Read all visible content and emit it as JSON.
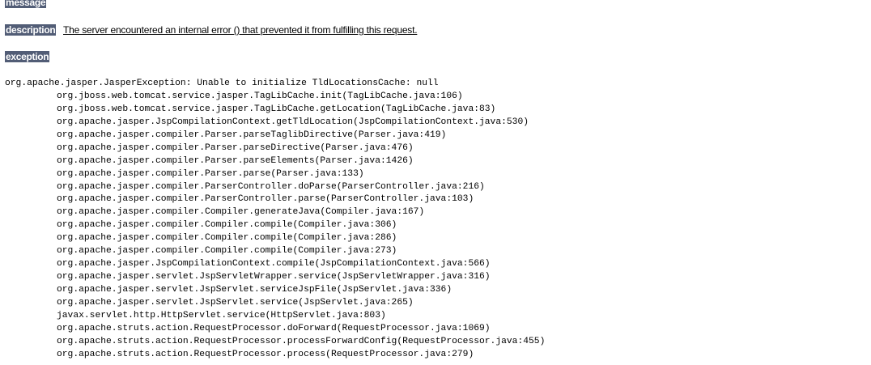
{
  "sections": {
    "message_label": "message",
    "description_label": "description",
    "description_text": "The server encountered an internal error () that prevented it from fulfilling this request.",
    "exception_label": "exception"
  },
  "exception": {
    "header": "org.apache.jasper.JasperException: Unable to initialize TldLocationsCache: null",
    "frames": [
      "org.jboss.web.tomcat.service.jasper.TagLibCache.init(TagLibCache.java:106)",
      "org.jboss.web.tomcat.service.jasper.TagLibCache.getLocation(TagLibCache.java:83)",
      "org.apache.jasper.JspCompilationContext.getTldLocation(JspCompilationContext.java:530)",
      "org.apache.jasper.compiler.Parser.parseTaglibDirective(Parser.java:419)",
      "org.apache.jasper.compiler.Parser.parseDirective(Parser.java:476)",
      "org.apache.jasper.compiler.Parser.parseElements(Parser.java:1426)",
      "org.apache.jasper.compiler.Parser.parse(Parser.java:133)",
      "org.apache.jasper.compiler.ParserController.doParse(ParserController.java:216)",
      "org.apache.jasper.compiler.ParserController.parse(ParserController.java:103)",
      "org.apache.jasper.compiler.Compiler.generateJava(Compiler.java:167)",
      "org.apache.jasper.compiler.Compiler.compile(Compiler.java:306)",
      "org.apache.jasper.compiler.Compiler.compile(Compiler.java:286)",
      "org.apache.jasper.compiler.Compiler.compile(Compiler.java:273)",
      "org.apache.jasper.JspCompilationContext.compile(JspCompilationContext.java:566)",
      "org.apache.jasper.servlet.JspServletWrapper.service(JspServletWrapper.java:316)",
      "org.apache.jasper.servlet.JspServlet.serviceJspFile(JspServlet.java:336)",
      "org.apache.jasper.servlet.JspServlet.service(JspServlet.java:265)",
      "javax.servlet.http.HttpServlet.service(HttpServlet.java:803)",
      "org.apache.struts.action.RequestProcessor.doForward(RequestProcessor.java:1069)",
      "org.apache.struts.action.RequestProcessor.processForwardConfig(RequestProcessor.java:455)",
      "org.apache.struts.action.RequestProcessor.process(RequestProcessor.java:279)"
    ]
  },
  "colors": {
    "label_background": "#525d76",
    "label_text": "#ffffff",
    "page_background": "#ffffff"
  }
}
